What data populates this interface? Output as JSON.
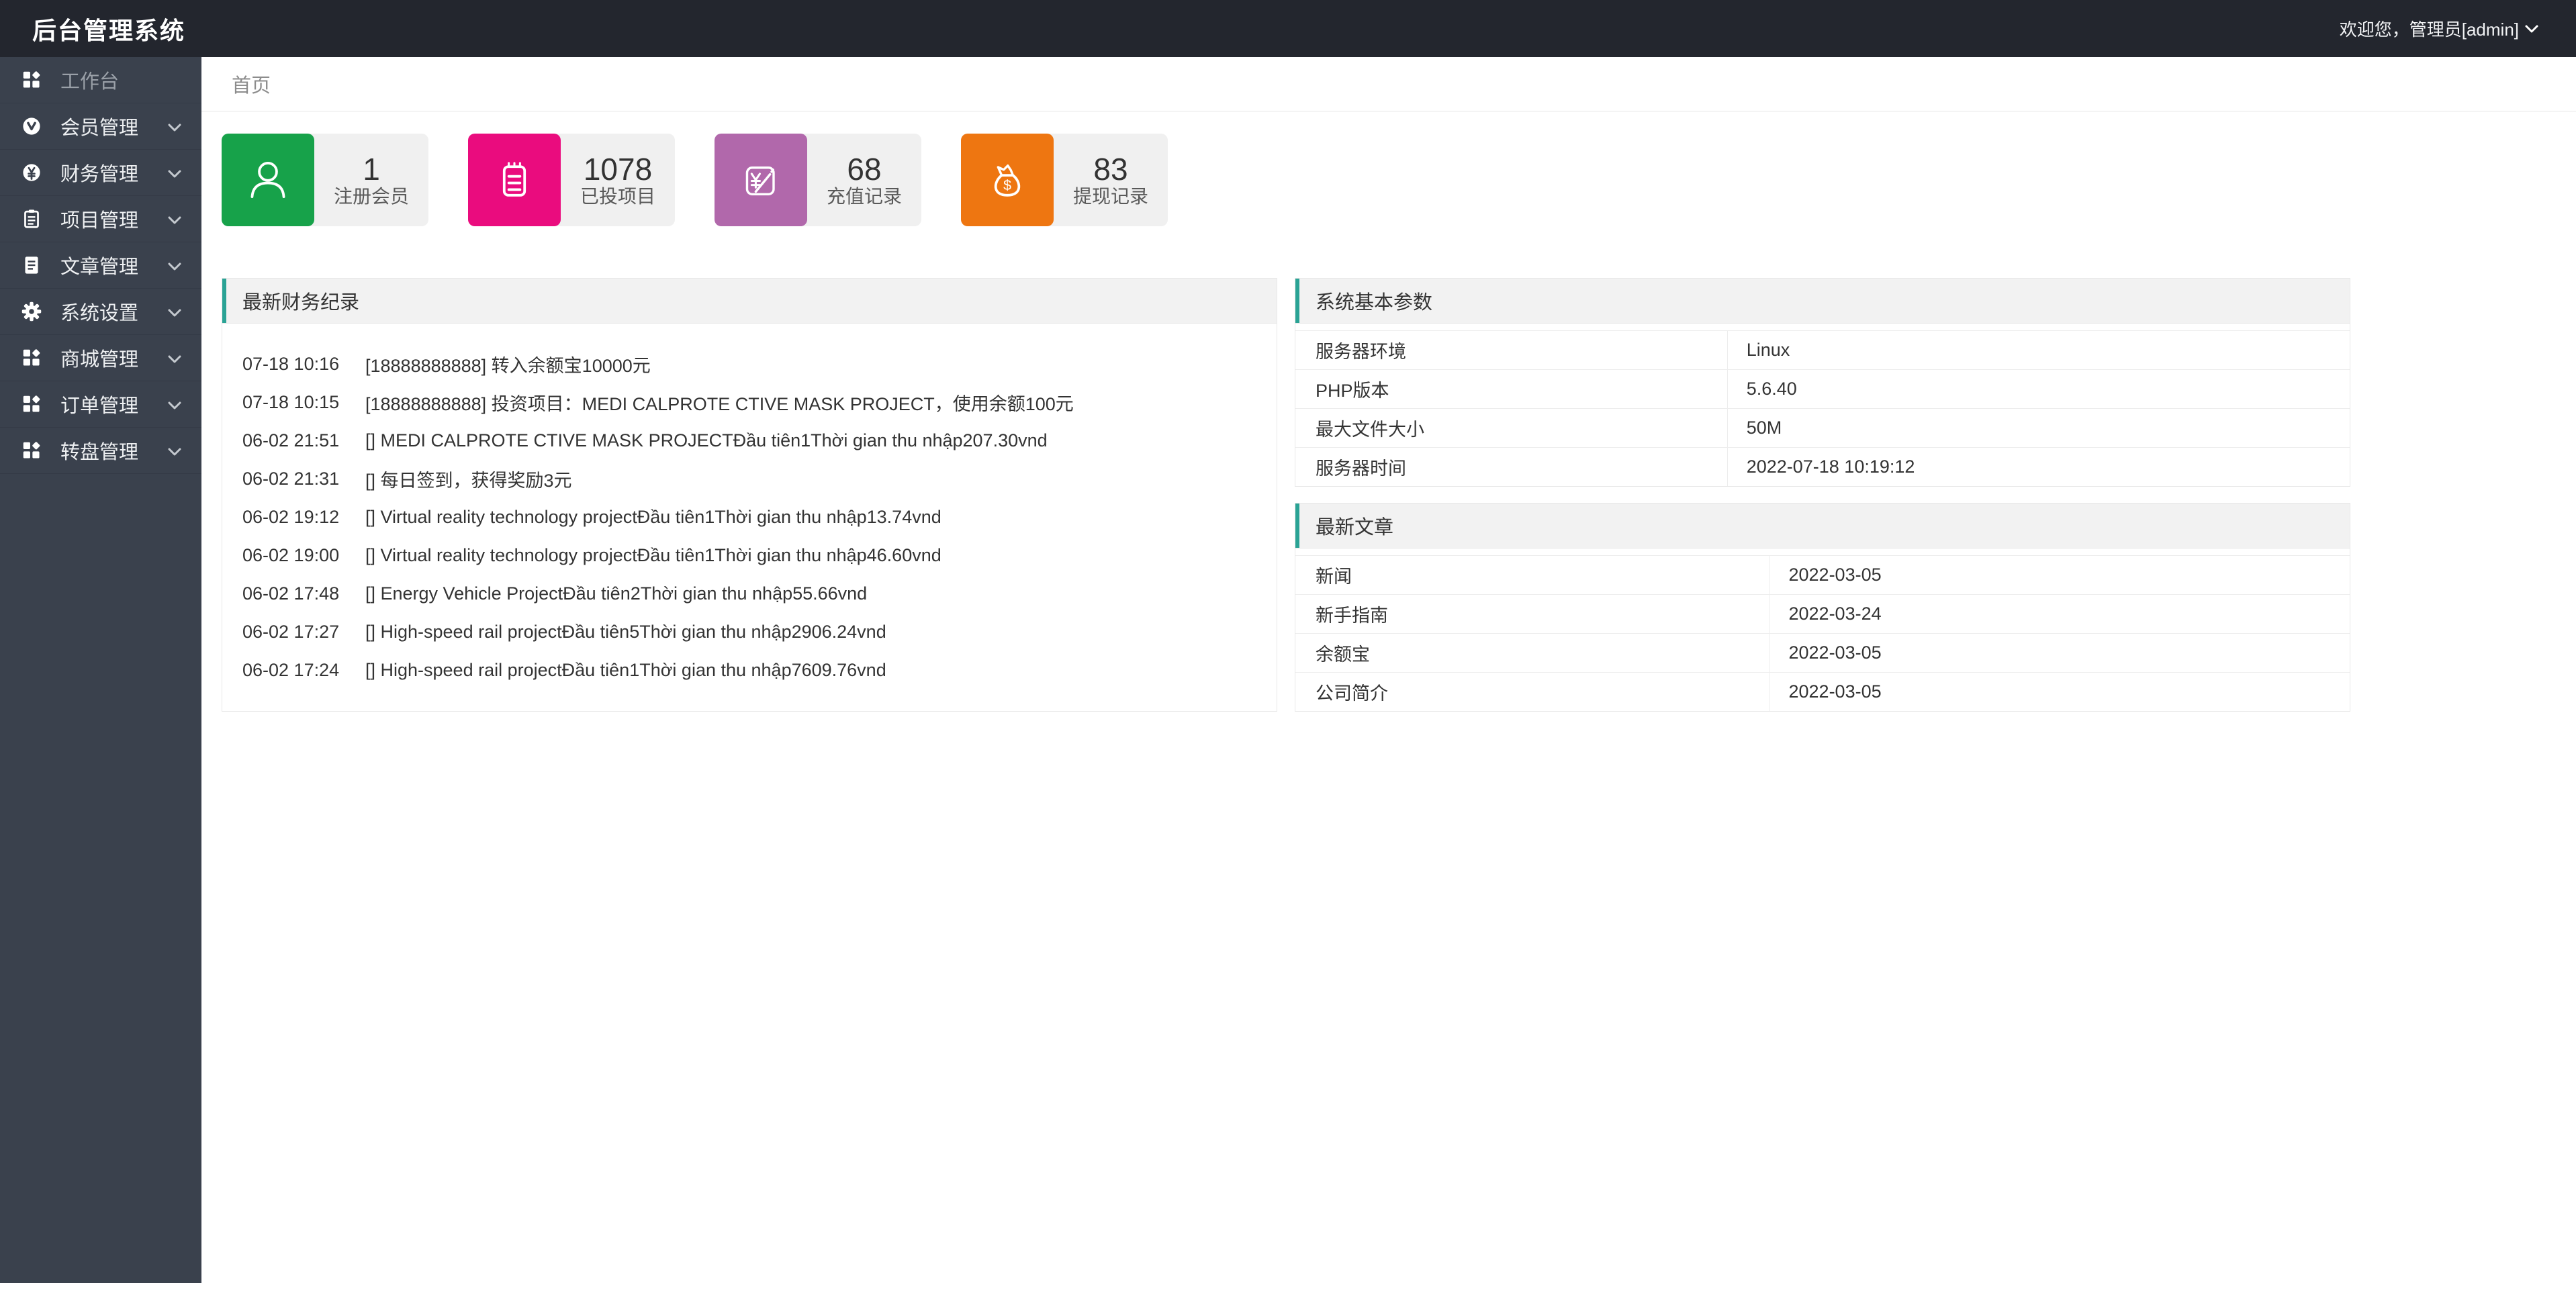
{
  "header": {
    "title": "后台管理系统",
    "welcome": "欢迎您，管理员[admin]"
  },
  "breadcrumb": {
    "home": "首页"
  },
  "sidebar": {
    "items": [
      {
        "label": "工作台",
        "icon": "grid-icon",
        "has_children": false
      },
      {
        "label": "会员管理",
        "icon": "member-icon",
        "has_children": true
      },
      {
        "label": "财务管理",
        "icon": "yen-circle-icon",
        "has_children": true
      },
      {
        "label": "项目管理",
        "icon": "clipboard-icon",
        "has_children": true
      },
      {
        "label": "文章管理",
        "icon": "document-icon",
        "has_children": true
      },
      {
        "label": "系统设置",
        "icon": "gear-icon",
        "has_children": true
      },
      {
        "label": "商城管理",
        "icon": "grid-icon",
        "has_children": true
      },
      {
        "label": "订单管理",
        "icon": "grid-icon",
        "has_children": true
      },
      {
        "label": "转盘管理",
        "icon": "grid-icon",
        "has_children": true
      }
    ]
  },
  "stats": [
    {
      "value": "1",
      "label": "注册会员",
      "color": "#17a24a",
      "icon": "user-icon"
    },
    {
      "value": "1078",
      "label": "已投项目",
      "color": "#ea0c7e",
      "icon": "notepad-icon"
    },
    {
      "value": "68",
      "label": "充值记录",
      "color": "#b168ab",
      "icon": "yen-edit-icon"
    },
    {
      "value": "83",
      "label": "提现记录",
      "color": "#ee7611",
      "icon": "moneybag-icon"
    }
  ],
  "finance_panel": {
    "title": "最新财务纪录",
    "records": [
      {
        "time": "07-18 10:16",
        "text": "[18888888888] 转入余额宝10000元"
      },
      {
        "time": "07-18 10:15",
        "text": "[18888888888] 投资项目：MEDI CALPROTE CTIVE MASK PROJECT，使用余额100元"
      },
      {
        "time": "06-02 21:51",
        "text": "[] MEDI CALPROTE CTIVE MASK PROJECTĐầu tiên1Thời gian thu nhập207.30vnd"
      },
      {
        "time": "06-02 21:31",
        "text": "[] 每日签到，获得奖励3元"
      },
      {
        "time": "06-02 19:12",
        "text": "[] Virtual reality technology projectĐầu tiên1Thời gian thu nhập13.74vnd"
      },
      {
        "time": "06-02 19:00",
        "text": "[] Virtual reality technology projectĐầu tiên1Thời gian thu nhập46.60vnd"
      },
      {
        "time": "06-02 17:48",
        "text": "[] Energy Vehicle ProjectĐầu tiên2Thời gian thu nhập55.66vnd"
      },
      {
        "time": "06-02 17:27",
        "text": "[] High-speed rail projectĐầu tiên5Thời gian thu nhập2906.24vnd"
      },
      {
        "time": "06-02 17:24",
        "text": "[] High-speed rail projectĐầu tiên1Thời gian thu nhập7609.76vnd"
      }
    ]
  },
  "system_panel": {
    "title": "系统基本参数",
    "rows": [
      {
        "label": "服务器环境",
        "value": "Linux"
      },
      {
        "label": "PHP版本",
        "value": "5.6.40"
      },
      {
        "label": "最大文件大小",
        "value": "50M"
      },
      {
        "label": "服务器时间",
        "value": "2022-07-18 10:19:12"
      }
    ]
  },
  "articles_panel": {
    "title": "最新文章",
    "rows": [
      {
        "label": "新闻",
        "value": "2022-03-05"
      },
      {
        "label": "新手指南",
        "value": "2022-03-24"
      },
      {
        "label": "余额宝",
        "value": "2022-03-05"
      },
      {
        "label": "公司简介",
        "value": "2022-03-05"
      }
    ]
  },
  "colors": {
    "topbar_bg": "#23262e",
    "sidebar_bg": "#3a414d",
    "accent_teal": "#2aa395",
    "stat_green": "#17a24a",
    "stat_magenta": "#ea0c7e",
    "stat_purple": "#b168ab",
    "stat_orange": "#ee7611"
  }
}
